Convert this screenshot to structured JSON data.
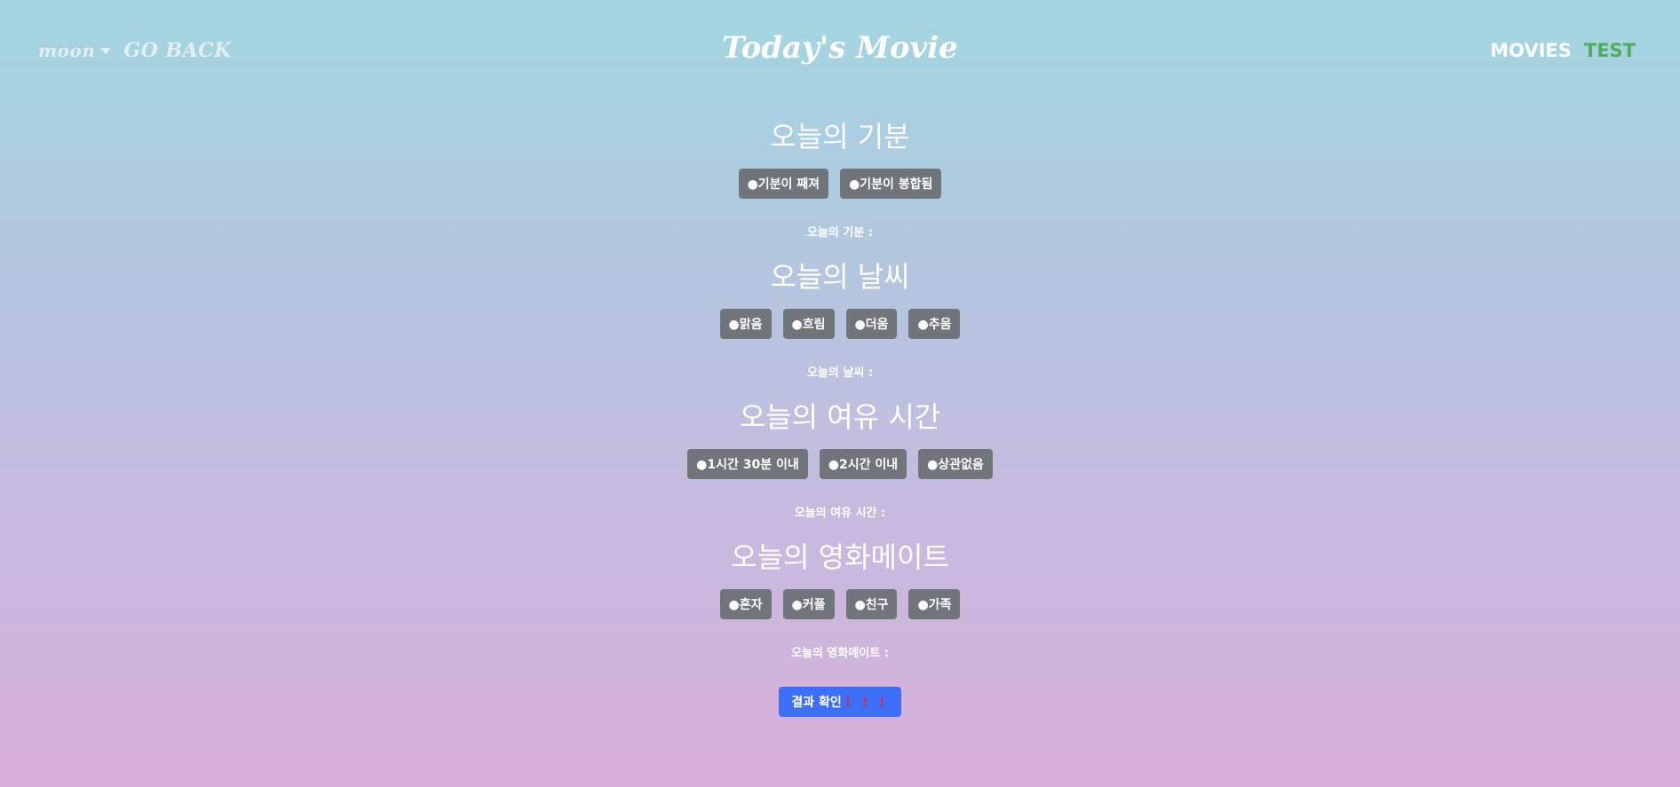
{
  "nav": {
    "user": "moon",
    "go_back": "GO BACK",
    "brand": "Today's Movie",
    "movies": "MOVIES",
    "test": "TEST"
  },
  "sections": [
    {
      "title": "오늘의 기분",
      "options": [
        "●기분이 째져",
        "●기분이 봉합됨"
      ],
      "result_label": "오늘의 기분 :"
    },
    {
      "title": "오늘의 날씨",
      "options": [
        "●맑음",
        "●흐림",
        "●더움",
        "●추움"
      ],
      "result_label": "오늘의 날씨 :"
    },
    {
      "title": "오늘의 여유 시간",
      "options": [
        "●1시간 30분 이내",
        "●2시간 이내",
        "●상관없음"
      ],
      "result_label": "오늘의 여유 시간 :"
    },
    {
      "title": "오늘의 영화메이트",
      "options": [
        "●혼자",
        "●커플",
        "●친구",
        "●가족"
      ],
      "result_label": "오늘의 영화메이트 :"
    }
  ],
  "submit": {
    "label": "결과 확인",
    "emphasis": "! ! !"
  },
  "colors": {
    "option_button": "#6f757b",
    "submit_button": "#3d6ef8",
    "test_link": "#4cae5f",
    "emphasis": "#e0243a"
  }
}
